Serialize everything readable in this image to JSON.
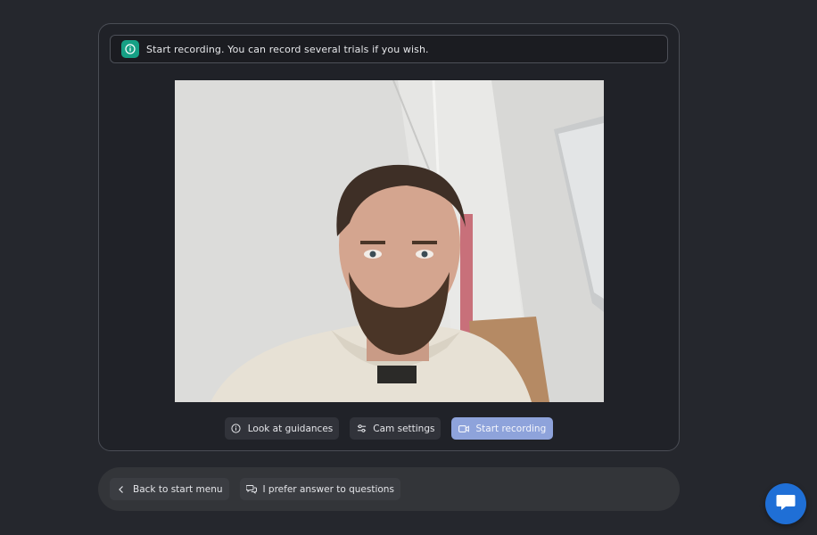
{
  "notice": {
    "text": "Start recording. You can record several trials if you wish.",
    "icon": "info-icon",
    "badge_color": "#16a085"
  },
  "preview": {
    "subject": "webcam-preview"
  },
  "controls": {
    "guidances_label": "Look at guidances",
    "guidances_icon": "info-icon",
    "cam_settings_label": "Cam settings",
    "cam_settings_icon": "sliders-icon",
    "start_recording_label": "Start recording",
    "start_recording_icon": "video-camera-icon",
    "primary_color": "#8ea3db"
  },
  "bottom_bar": {
    "back_label": "Back to start menu",
    "back_icon": "chevron-left-icon",
    "questions_label": "I prefer answer to questions",
    "questions_icon": "chat-bubbles-icon"
  },
  "chat_launcher": {
    "icon": "chat-icon",
    "color": "#1f6fd6"
  }
}
